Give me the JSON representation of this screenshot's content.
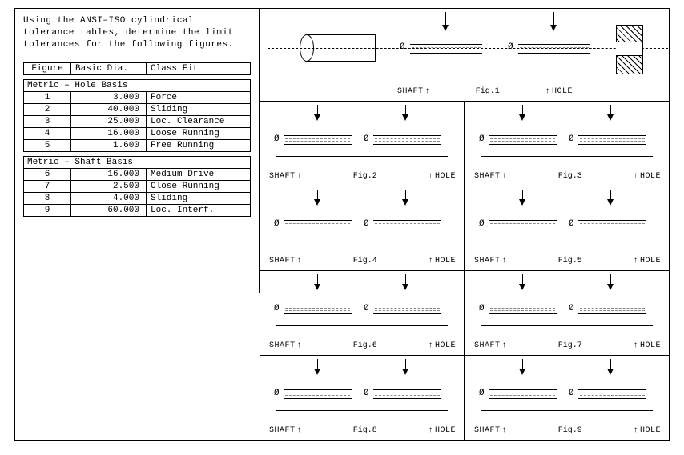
{
  "intro": "Using the ANSI–ISO cylindrical tolerance tables, determine the limit tolerances for the following figures.",
  "labels": {
    "shaft": "SHAFT",
    "hole": "HOLE",
    "figPrefix": "Fig.",
    "diameter": "Ø"
  },
  "table": {
    "headers": {
      "figure": "Figure",
      "basicDia": "Basic Dia.",
      "classFit": "Class Fit"
    },
    "sections": [
      {
        "title": "Metric – Hole Basis",
        "rows": [
          {
            "fig": "1",
            "dia": "3.000",
            "fit": "Force"
          },
          {
            "fig": "2",
            "dia": "40.000",
            "fit": "Sliding"
          },
          {
            "fig": "3",
            "dia": "25.000",
            "fit": "Loc. Clearance"
          },
          {
            "fig": "4",
            "dia": "16.000",
            "fit": "Loose Running"
          },
          {
            "fig": "5",
            "dia": "1.600",
            "fit": "Free Running"
          }
        ]
      },
      {
        "title": "Metric – Shaft Basis",
        "rows": [
          {
            "fig": "6",
            "dia": "16.000",
            "fit": "Medium Drive"
          },
          {
            "fig": "7",
            "dia": "2.500",
            "fit": "Close Running"
          },
          {
            "fig": "8",
            "dia": "4.000",
            "fit": "Sliding"
          },
          {
            "fig": "9",
            "dia": "60.000",
            "fit": "Loc. Interf."
          }
        ]
      }
    ]
  },
  "figures": {
    "f1": "Fig.1",
    "f2": "Fig.2",
    "f3": "Fig.3",
    "f4": "Fig.4",
    "f5": "Fig.5",
    "f6": "Fig.6",
    "f7": "Fig.7",
    "f8": "Fig.8",
    "f9": "Fig.9"
  }
}
